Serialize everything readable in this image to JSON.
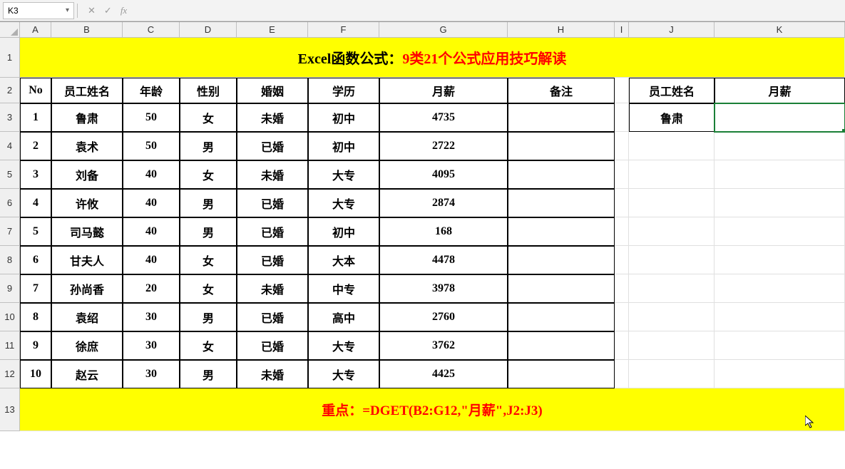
{
  "nameBox": "K3",
  "formulaBar": "",
  "columns": [
    "A",
    "B",
    "C",
    "D",
    "E",
    "F",
    "G",
    "H",
    "I",
    "J",
    "K"
  ],
  "rowNumbers": [
    "1",
    "2",
    "3",
    "4",
    "5",
    "6",
    "7",
    "8",
    "9",
    "10",
    "11",
    "12",
    "13"
  ],
  "title": {
    "part1": "Excel函数公式：",
    "part2": "9类21个公式应用技巧解读"
  },
  "headers": {
    "no": "No",
    "name": "员工姓名",
    "age": "年龄",
    "gender": "性别",
    "marriage": "婚姻",
    "education": "学历",
    "salary": "月薪",
    "remark": "备注",
    "lookupName": "员工姓名",
    "lookupSalary": "月薪"
  },
  "rows": [
    {
      "no": "1",
      "name": "鲁肃",
      "age": "50",
      "gender": "女",
      "marriage": "未婚",
      "education": "初中",
      "salary": "4735",
      "remark": ""
    },
    {
      "no": "2",
      "name": "袁术",
      "age": "50",
      "gender": "男",
      "marriage": "已婚",
      "education": "初中",
      "salary": "2722",
      "remark": ""
    },
    {
      "no": "3",
      "name": "刘备",
      "age": "40",
      "gender": "女",
      "marriage": "未婚",
      "education": "大专",
      "salary": "4095",
      "remark": ""
    },
    {
      "no": "4",
      "name": "许攸",
      "age": "40",
      "gender": "男",
      "marriage": "已婚",
      "education": "大专",
      "salary": "2874",
      "remark": ""
    },
    {
      "no": "5",
      "name": "司马懿",
      "age": "40",
      "gender": "男",
      "marriage": "已婚",
      "education": "初中",
      "salary": "168",
      "remark": ""
    },
    {
      "no": "6",
      "name": "甘夫人",
      "age": "40",
      "gender": "女",
      "marriage": "已婚",
      "education": "大本",
      "salary": "4478",
      "remark": ""
    },
    {
      "no": "7",
      "name": "孙尚香",
      "age": "20",
      "gender": "女",
      "marriage": "未婚",
      "education": "中专",
      "salary": "3978",
      "remark": ""
    },
    {
      "no": "8",
      "name": "袁绍",
      "age": "30",
      "gender": "男",
      "marriage": "已婚",
      "education": "高中",
      "salary": "2760",
      "remark": ""
    },
    {
      "no": "9",
      "name": "徐庶",
      "age": "30",
      "gender": "女",
      "marriage": "已婚",
      "education": "大专",
      "salary": "3762",
      "remark": ""
    },
    {
      "no": "10",
      "name": "赵云",
      "age": "30",
      "gender": "男",
      "marriage": "未婚",
      "education": "大专",
      "salary": "4425",
      "remark": ""
    }
  ],
  "lookup": {
    "name": "鲁肃",
    "salary": ""
  },
  "footer": {
    "label": "重点：",
    "formula": "=DGET(B2:G12,\"月薪\",J2:J3)"
  }
}
